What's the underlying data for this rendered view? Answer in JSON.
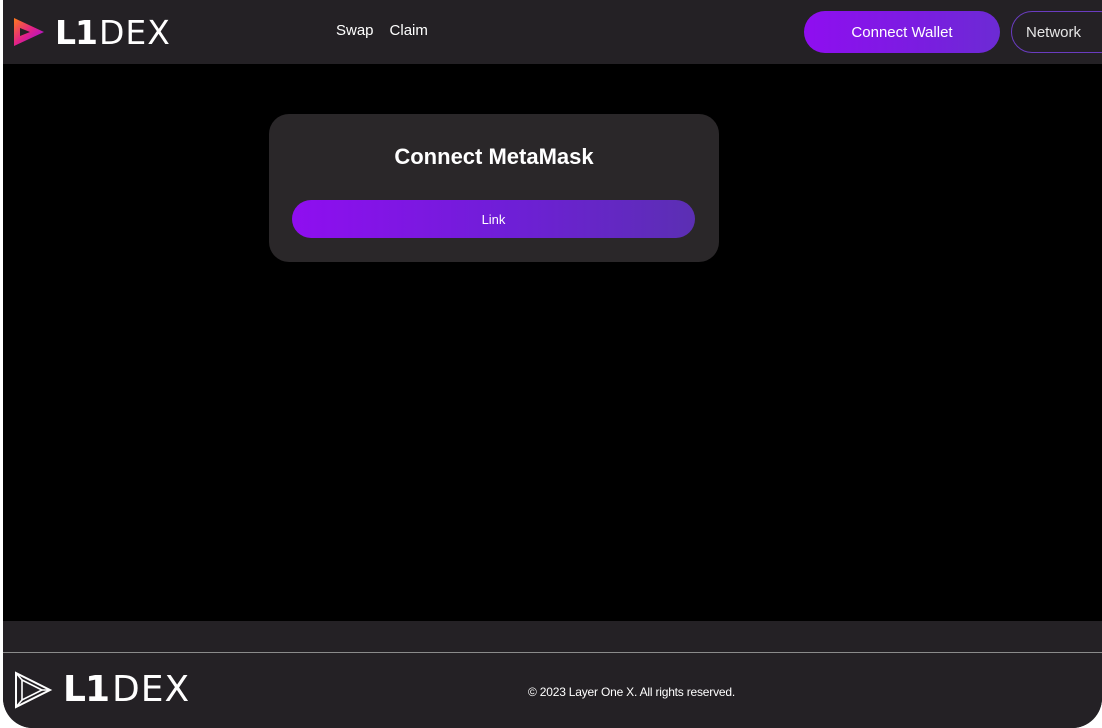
{
  "header": {
    "logo": {
      "l1": "L1",
      "dex": "DEX",
      "icon": "l1-play-logo-icon"
    },
    "nav": [
      {
        "label": "Swap"
      },
      {
        "label": "Claim"
      }
    ],
    "connect_wallet_label": "Connect Wallet",
    "network_label": "Network"
  },
  "card": {
    "title": "Connect MetaMask",
    "button_label": "Link"
  },
  "footer": {
    "logo": {
      "l1": "L1",
      "dex": "DEX",
      "icon": "l1-outline-logo-icon"
    },
    "copyright": "© 2023 Layer One X. All rights reserved."
  },
  "colors": {
    "background": "#000000",
    "bar": "#242125",
    "card": "#2a2729",
    "accent": "#8f0ef0",
    "accent_end": "#5b2fb3"
  }
}
